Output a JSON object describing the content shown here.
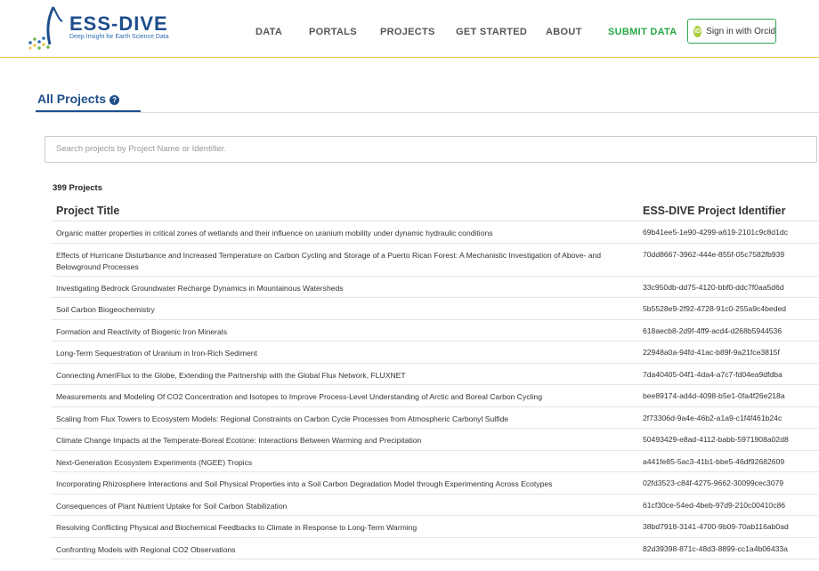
{
  "brand": {
    "title": "ESS-DIVE",
    "subtitle": "Deep Insight for Earth Science Data"
  },
  "nav": {
    "items": [
      {
        "label": "DATA"
      },
      {
        "label": "PORTALS"
      },
      {
        "label": "PROJECTS"
      },
      {
        "label": "GET STARTED"
      },
      {
        "label": "ABOUT"
      },
      {
        "label": "SUBMIT DATA"
      }
    ],
    "signin_label": "Sign in with Orcid",
    "orcid_badge": "iD"
  },
  "page": {
    "tab_label": "All Projects",
    "help_glyph": "?",
    "search_placeholder": "Search projects by Project Name or Identifier.",
    "count": "399 Projects"
  },
  "table": {
    "headers": [
      "Project Title",
      "ESS-DIVE Project Identifier"
    ],
    "rows": [
      {
        "title": "Organic matter properties in critical zones of wetlands and their influence on uranium mobility under dynamic hydraulic conditions",
        "id": "69b41ee5-1e90-4299-a619-2101c9c8d1dc"
      },
      {
        "title": "Effects of Hurricane Disturbance and Increased Temperature on Carbon Cycling and Storage of a Puerto Rican Forest: A Mechanistic Investigation of Above- and Belowground Processes",
        "id": "70dd8667-3962-444e-855f-05c7582fb939"
      },
      {
        "title": "Investigating Bedrock Groundwater Recharge Dynamics in Mountainous Watersheds",
        "id": "33c950db-dd75-4120-bbf0-ddc7f0aa5d6d"
      },
      {
        "title": "Soil Carbon Biogeochemistry",
        "id": "5b5528e9-2f92-4728-91c0-255a9c4beded"
      },
      {
        "title": "Formation and Reactivity of Biogenic Iron Minerals",
        "id": "618aecb8-2d9f-4ff9-acd4-d268b5944536"
      },
      {
        "title": "Long-Term Sequestration of Uranium in Iron-Rich Sediment",
        "id": "22948a0a-94fd-41ac-b89f-9a21fce3815f"
      },
      {
        "title": "Connecting AmeriFlux to the Globe, Extending the Partnership with the Global Flux Network, FLUXNET",
        "id": "7da40405-04f1-4da4-a7c7-fd04ea9dfdba"
      },
      {
        "title": "Measurements and Modeling Of CO2 Concentration and Isotopes to Improve Process-Level Understanding of Arctic and Boreal Carbon Cycling",
        "id": "bee89174-ad4d-4098-b5e1-0fa4f26e218a"
      },
      {
        "title": "Scaling from Flux Towers to Ecosystem Models: Regional Constraints on Carbon Cycle Processes from Atmospheric Carbonyl Sulfide",
        "id": "2f73306d-9a4e-46b2-a1a9-c1f4f461b24c"
      },
      {
        "title": "Climate Change Impacts at the Temperate-Boreal Ecotone: Interactions Between Warming and Precipitation",
        "id": "50493429-e8ad-4112-babb-5971908a02d8"
      },
      {
        "title": "Next-Generation Ecosystem Experiments (NGEE) Tropics",
        "id": "a441fe85-5ac3-41b1-bbe5-46df92682609"
      },
      {
        "title": "Incorporating Rhizosphere Interactions and Soil Physical Properties into a Soil Carbon Degradation Model through Experimenting Across Ecotypes",
        "id": "02fd3523-c84f-4275-9662-30099cec3079"
      },
      {
        "title": "Consequences of Plant Nutrient Uptake for Soil Carbon Stabilization",
        "id": "61cf30ce-54ed-4beb-97d9-210c00410c86"
      },
      {
        "title": "Resolving Conflicting Physical and Biochemical Feedbacks to Climate in Response to Long-Term Warming",
        "id": "38bd7918-3141-4700-9b09-70ab116ab0ad"
      },
      {
        "title": "Confronting Models with Regional CO2 Observations",
        "id": "82d39398-871c-48d3-8899-cc1a4b06433a"
      }
    ]
  },
  "colors": {
    "brand_blue": "#1f4e8c",
    "submit_green": "#28a745",
    "header_rule": "#f2c64a",
    "orcid_green": "#a6ce39"
  }
}
